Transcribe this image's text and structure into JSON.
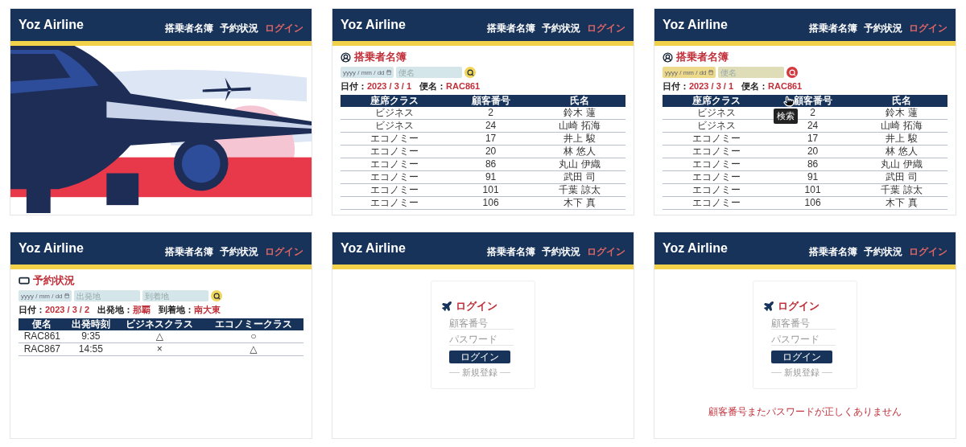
{
  "panels": [
    {
      "kind": "hero",
      "brand": "Yoz Airline",
      "nav": [
        {
          "label": "搭乗者名簿",
          "accent": false
        },
        {
          "label": "予約状況",
          "accent": false
        },
        {
          "label": "ログイン",
          "accent": true
        }
      ]
    },
    {
      "kind": "manifest",
      "brand": "Yoz Airline",
      "nav": [
        {
          "label": "搭乗者名簿",
          "accent": false
        },
        {
          "label": "予約状況",
          "accent": false
        },
        {
          "label": "ログイン",
          "accent": true
        }
      ],
      "title": "搭乗者名簿",
      "date_placeholder": "yyyy / mm / dd",
      "fields": [
        {
          "placeholder": "便名"
        }
      ],
      "search_hovered": false,
      "info": [
        {
          "label": "日付：",
          "value": "2023 / 3 / 1"
        },
        {
          "label": "便名：",
          "value": "RAC861"
        }
      ],
      "columns": [
        "座席クラス",
        "顧客番号",
        "氏名"
      ],
      "rows": [
        [
          "ビジネス",
          "2",
          "鈴木 蓮"
        ],
        [
          "ビジネス",
          "24",
          "山崎 拓海"
        ],
        [
          "エコノミー",
          "17",
          "井上 駿"
        ],
        [
          "エコノミー",
          "20",
          "林 悠人"
        ],
        [
          "エコノミー",
          "86",
          "丸山 伊織"
        ],
        [
          "エコノミー",
          "91",
          "武田 司"
        ],
        [
          "エコノミー",
          "101",
          "千葉 諒太"
        ],
        [
          "エコノミー",
          "106",
          "木下 真"
        ]
      ]
    },
    {
      "kind": "manifest",
      "brand": "Yoz Airline",
      "nav": [
        {
          "label": "搭乗者名簿",
          "accent": false
        },
        {
          "label": "予約状況",
          "accent": false
        },
        {
          "label": "ログイン",
          "accent": true
        }
      ],
      "title": "搭乗者名簿",
      "date_placeholder": "yyyy / mm / dd",
      "fields": [
        {
          "placeholder": "便名"
        }
      ],
      "search_hovered": true,
      "tooltip": "検索",
      "info": [
        {
          "label": "日付：",
          "value": "2023 / 3 / 1"
        },
        {
          "label": "便名：",
          "value": "RAC861"
        }
      ],
      "columns": [
        "座席クラス",
        "顧客番号",
        "氏名"
      ],
      "rows": [
        [
          "ビジネス",
          "2",
          "鈴木 蓮"
        ],
        [
          "ビジネス",
          "24",
          "山崎 拓海"
        ],
        [
          "エコノミー",
          "17",
          "井上 駿"
        ],
        [
          "エコノミー",
          "20",
          "林 悠人"
        ],
        [
          "エコノミー",
          "86",
          "丸山 伊織"
        ],
        [
          "エコノミー",
          "91",
          "武田 司"
        ],
        [
          "エコノミー",
          "101",
          "千葉 諒太"
        ],
        [
          "エコノミー",
          "106",
          "木下 真"
        ]
      ]
    },
    {
      "kind": "reservation",
      "brand": "Yoz Airline",
      "nav": [
        {
          "label": "搭乗者名簿",
          "accent": false
        },
        {
          "label": "予約状況",
          "accent": false
        },
        {
          "label": "ログイン",
          "accent": true
        }
      ],
      "title": "予約状況",
      "date_placeholder": "yyyy / mm / dd",
      "fields": [
        {
          "placeholder": "出発地"
        },
        {
          "placeholder": "到着地"
        }
      ],
      "search_hovered": false,
      "info": [
        {
          "label": "日付：",
          "value": "2023 / 3 / 2"
        },
        {
          "label": "出発地：",
          "value": "那覇"
        },
        {
          "label": "到着地：",
          "value": "南大東"
        }
      ],
      "columns": [
        "便名",
        "出発時刻",
        "ビジネスクラス",
        "エコノミークラス"
      ],
      "rows": [
        [
          "RAC861",
          "9:35",
          "△",
          "○"
        ],
        [
          "RAC867",
          "14:55",
          "×",
          "△"
        ]
      ]
    },
    {
      "kind": "login",
      "brand": "Yoz Airline",
      "nav": [
        {
          "label": "搭乗者名簿",
          "accent": false
        },
        {
          "label": "予約状況",
          "accent": false
        },
        {
          "label": "ログイン",
          "accent": true
        }
      ],
      "title": "ログイン",
      "fields": [
        {
          "placeholder": "顧客番号"
        },
        {
          "placeholder": "パスワード"
        }
      ],
      "button": "ログイン",
      "register": "新規登録"
    },
    {
      "kind": "login",
      "brand": "Yoz Airline",
      "nav": [
        {
          "label": "搭乗者名簿",
          "accent": false
        },
        {
          "label": "予約状況",
          "accent": false
        },
        {
          "label": "ログイン",
          "accent": true
        }
      ],
      "title": "ログイン",
      "fields": [
        {
          "placeholder": "顧客番号"
        },
        {
          "placeholder": "パスワード"
        }
      ],
      "button": "ログイン",
      "register": "新規登録",
      "error": "顧客番号またパスワードが正しくありません"
    }
  ]
}
